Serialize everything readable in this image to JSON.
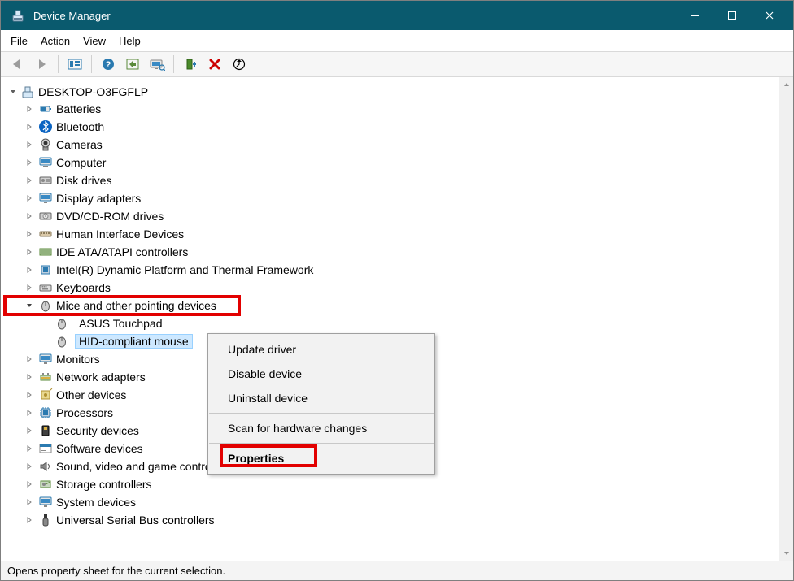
{
  "window": {
    "title": "Device Manager"
  },
  "menu": {
    "file": "File",
    "action": "Action",
    "view": "View",
    "help": "Help"
  },
  "tree": {
    "root": "DESKTOP-O3FGFLP",
    "categories": [
      {
        "label": "Batteries"
      },
      {
        "label": "Bluetooth"
      },
      {
        "label": "Cameras"
      },
      {
        "label": "Computer"
      },
      {
        "label": "Disk drives"
      },
      {
        "label": "Display adapters"
      },
      {
        "label": "DVD/CD-ROM drives"
      },
      {
        "label": "Human Interface Devices"
      },
      {
        "label": "IDE ATA/ATAPI controllers"
      },
      {
        "label": "Intel(R) Dynamic Platform and Thermal Framework"
      },
      {
        "label": "Keyboards"
      },
      {
        "label": "Mice and other pointing devices",
        "expanded": true,
        "children": [
          {
            "label": "ASUS Touchpad"
          },
          {
            "label": "HID-compliant mouse",
            "selected": true
          }
        ]
      },
      {
        "label": "Monitors"
      },
      {
        "label": "Network adapters"
      },
      {
        "label": "Other devices"
      },
      {
        "label": "Processors"
      },
      {
        "label": "Security devices"
      },
      {
        "label": "Software devices"
      },
      {
        "label": "Sound, video and game controllers"
      },
      {
        "label": "Storage controllers"
      },
      {
        "label": "System devices"
      },
      {
        "label": "Universal Serial Bus controllers"
      }
    ]
  },
  "contextMenu": {
    "update": "Update driver",
    "disable": "Disable device",
    "uninstall": "Uninstall device",
    "scan": "Scan for hardware changes",
    "properties": "Properties"
  },
  "status": "Opens property sheet for the current selection."
}
